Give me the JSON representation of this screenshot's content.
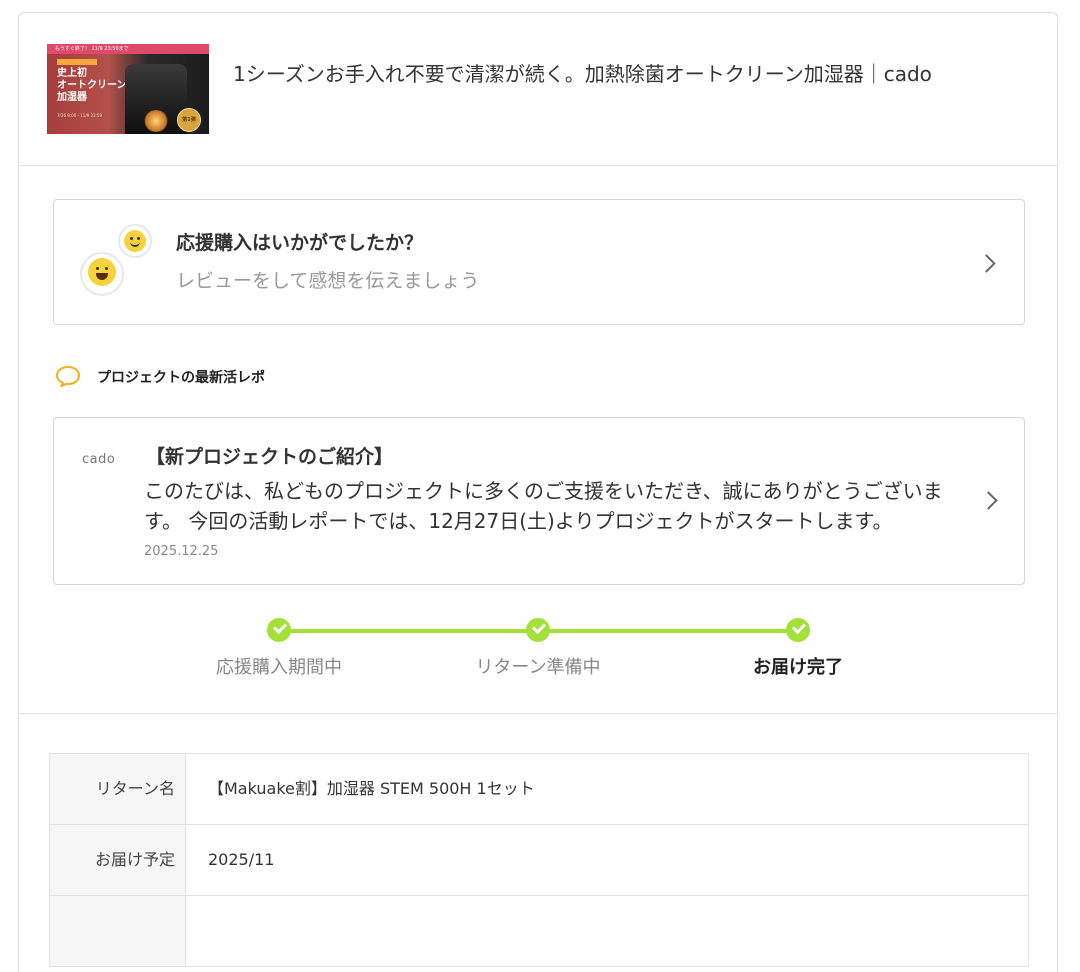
{
  "project": {
    "title": "1シーズンお手入れ不要で清潔が続く。加熱除菌オートクリーン加湿器｜cado",
    "thumbnail": {
      "banner_text": "もうすぐ終了！ 11/9 23:59まで",
      "headline": "史上初\nオートクリーン\n加湿器",
      "small_text": "7/26 9:00 - 11/9 23:59",
      "badge": "第1弾"
    }
  },
  "review_prompt": {
    "title": "応援購入はいかがでしたか？",
    "subtitle": "レビューをして感想を伝えましょう"
  },
  "activity": {
    "heading": "プロジェクトの最新活レポ",
    "logo": "cado",
    "title": "【新プロジェクトのご紹介】",
    "body": "このたびは、私どものプロジェクトに多くのご支援をいただき、誠にありがとうございます。 今回の活動レポートでは、12月27日(土)よりプロジェクトがスタートします。",
    "date": "2025.12.25"
  },
  "progress": {
    "steps": [
      {
        "label": "応援購入期間中",
        "done": true,
        "active": false
      },
      {
        "label": "リターン準備中",
        "done": true,
        "active": false
      },
      {
        "label": "お届け完了",
        "done": true,
        "active": true
      }
    ],
    "color": "#a4e03a"
  },
  "details": {
    "rows": [
      {
        "label": "リターン名",
        "value": "【Makuake割】加湿器 STEM 500H 1セット"
      },
      {
        "label": "お届け予定",
        "value": "2025/11"
      }
    ]
  }
}
